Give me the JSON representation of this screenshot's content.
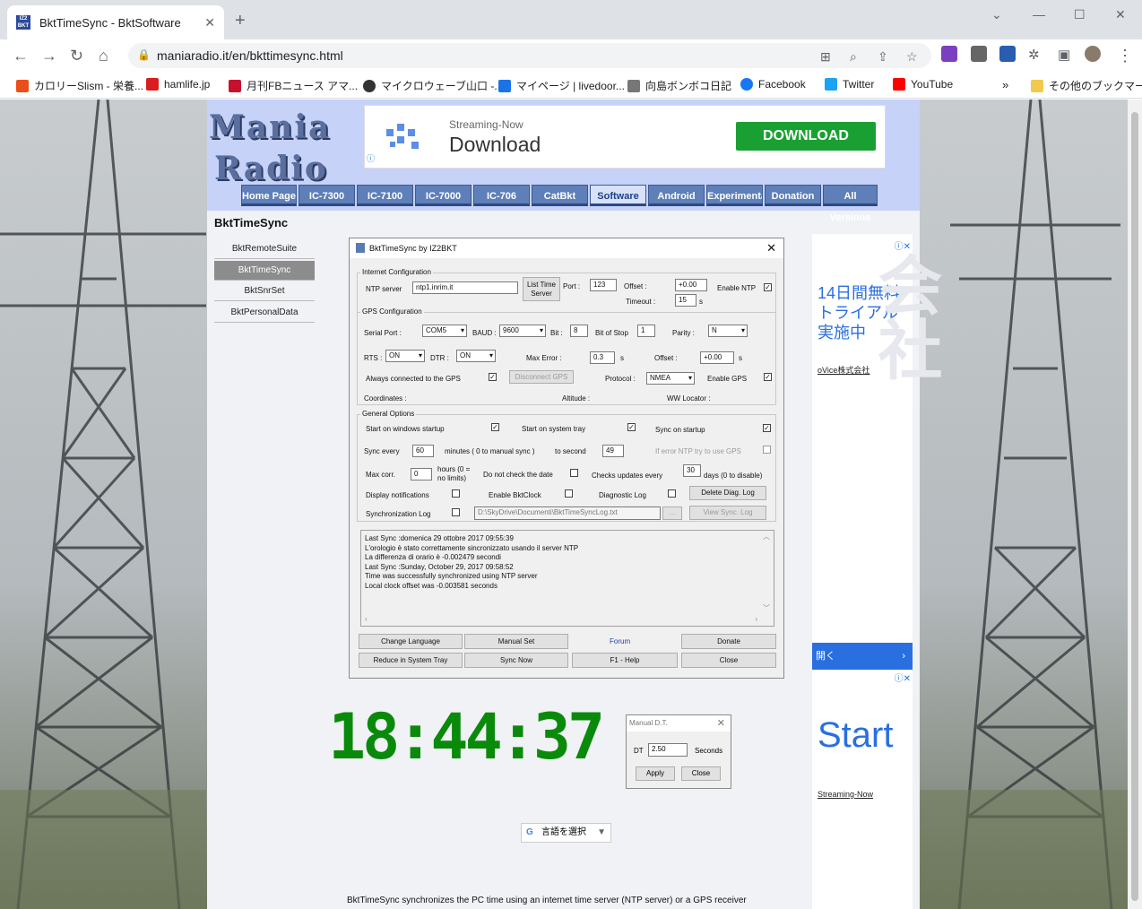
{
  "browser": {
    "tab_title": "BktTimeSync - BktSoftware",
    "tab_favicon": "IZ2 BKT",
    "url": "maniaradio.it/en/bkttimesync.html",
    "bookmarks": [
      {
        "label": "カロリーSlism - 栄養...",
        "icon": "slism-icon",
        "color": "#e94e1b"
      },
      {
        "label": "hamlife.jp",
        "icon": "hamlife-icon",
        "color": "#d81e1e"
      },
      {
        "label": "月刊FBニュース アマ...",
        "icon": "fb-news-icon",
        "color": "#c8102e"
      },
      {
        "label": "マイクロウェーブ山口 -...",
        "icon": "github-icon",
        "color": "#333333"
      },
      {
        "label": "マイページ | livedoor...",
        "icon": "livedoor-icon",
        "color": "#1a73e8"
      },
      {
        "label": "向島ボンボコ日記",
        "icon": "avatar-icon",
        "color": "#777777"
      },
      {
        "label": "Facebook",
        "icon": "facebook-icon",
        "color": "#1877f2"
      },
      {
        "label": "Twitter",
        "icon": "twitter-icon",
        "color": "#1da1f2"
      },
      {
        "label": "YouTube",
        "icon": "youtube-icon",
        "color": "#ff0000"
      }
    ],
    "bookmarks_more": "»",
    "other_bookmarks": "その他のブックマーク"
  },
  "site": {
    "logo_line1": "Mania",
    "logo_line2": "Radio",
    "ad_top": {
      "small": "Streaming-Now",
      "big": "Download",
      "button": "DOWNLOAD"
    },
    "menu": [
      "Home Page",
      "IC-7300",
      "IC-7100",
      "IC-7000",
      "IC-706",
      "CatBkt",
      "Software",
      "Android",
      "Experimental",
      "Donation",
      "All Versions"
    ],
    "menu_active": "Software",
    "sidebar_title": "BktTimeSync",
    "sidebar": [
      "BktRemoteSuite",
      "BktTimeSync",
      "BktSnrSet",
      "BktPersonalData"
    ],
    "footer": "BktTimeSync synchronizes the PC time using an internet time server (NTP server) or a GPS receiver",
    "translate": "言語を選択",
    "ad_right": {
      "jp1": "14日間無料",
      "jp2": "トライアル",
      "jp3": "実施中",
      "company": "oVice株式会社",
      "open": "開く",
      "start": "Start",
      "streaming": "Streaming-Now"
    }
  },
  "app": {
    "title": "BktTimeSync by IZ2BKT",
    "internet": {
      "group": "Internet Configuration",
      "ntp_label": "NTP server",
      "ntp_value": "ntp1.inrim.it",
      "list_btn": "List Time Server",
      "port_label": "Port :",
      "port_value": "123",
      "offset_label": "Offset :",
      "offset_value": "+0.00",
      "timeout_label": "Timeout :",
      "timeout_value": "15",
      "timeout_unit": "s",
      "enable_ntp": "Enable NTP"
    },
    "gps": {
      "group": "GPS Configuration",
      "serial_label": "Serial Port :",
      "serial_value": "COM5",
      "baud_label": "BAUD :",
      "baud_value": "9600",
      "bit_label": "Bit :",
      "bit_value": "8",
      "stop_label": "Bit of Stop",
      "stop_value": "1",
      "parity_label": "Parity :",
      "parity_value": "N",
      "rts_label": "RTS :",
      "rts_value": "ON",
      "dtr_label": "DTR :",
      "dtr_value": "ON",
      "maxerr_label": "Max Error :",
      "maxerr_value": "0.3",
      "maxerr_unit": "s",
      "offset_label": "Offset :",
      "offset_value": "+0.00",
      "offset_unit": "s",
      "always_label": "Always connected to the GPS",
      "disconnect_btn": "Disconnect GPS",
      "protocol_label": "Protocol :",
      "protocol_value": "NMEA",
      "enable_gps": "Enable GPS",
      "coords_label": "Coordinates :",
      "alt_label": "Altitude :",
      "ww_label": "WW Locator :"
    },
    "general": {
      "group": "General Options",
      "start_win": "Start on windows startup",
      "start_tray": "Start on system tray",
      "sync_startup": "Sync on startup",
      "sync_every_label": "Sync every",
      "sync_every_value": "60",
      "minutes_label": "minutes ( 0 to manual sync )",
      "to_second_label": "to second",
      "to_second_value": "49",
      "iferror": "If error NTP try to use GPS",
      "maxcorr_label": "Max corr.",
      "maxcorr_value": "0",
      "hours_label": "hours (0 = no limits)",
      "nocheck_date": "Do not check the date",
      "checks_updates": "Checks updates every",
      "checks_value": "30",
      "days_label": "days (0 to disable)",
      "display_notif": "Display notifications",
      "enable_clock": "Enable BktClock",
      "diag_log": "Diagnostic Log",
      "delete_diag": "Delete Diag. Log",
      "sync_log": "Synchronization Log",
      "log_path": "D:\\SkyDrive\\Documenti\\BktTimeSyncLog.txt",
      "browse": "...",
      "view_log": "View Sync. Log"
    },
    "log_lines": [
      "Last Sync :domenica 29 ottobre 2017 09:55:39",
      "L'orologio è stato correttamente sincronizzato usando il server NTP",
      "La differenza di orario è -0.002479 secondi",
      "Last Sync :Sunday, October 29, 2017 09:58:52",
      "Time was successfully synchronized using NTP server",
      "Local clock offset was -0.003581 seconds"
    ],
    "buttons": {
      "change_lang": "Change Language",
      "manual_set": "Manual Set",
      "forum": "Forum",
      "donate": "Donate",
      "reduce": "Reduce in System Tray",
      "sync_now": "Sync Now",
      "help": "F1 - Help",
      "close": "Close"
    }
  },
  "clock": "18:44:37",
  "manual_dt": {
    "title": "Manual D.T.",
    "dt_label": "DT",
    "dt_value": "2.50",
    "seconds": "Seconds",
    "apply": "Apply",
    "close": "Close"
  }
}
